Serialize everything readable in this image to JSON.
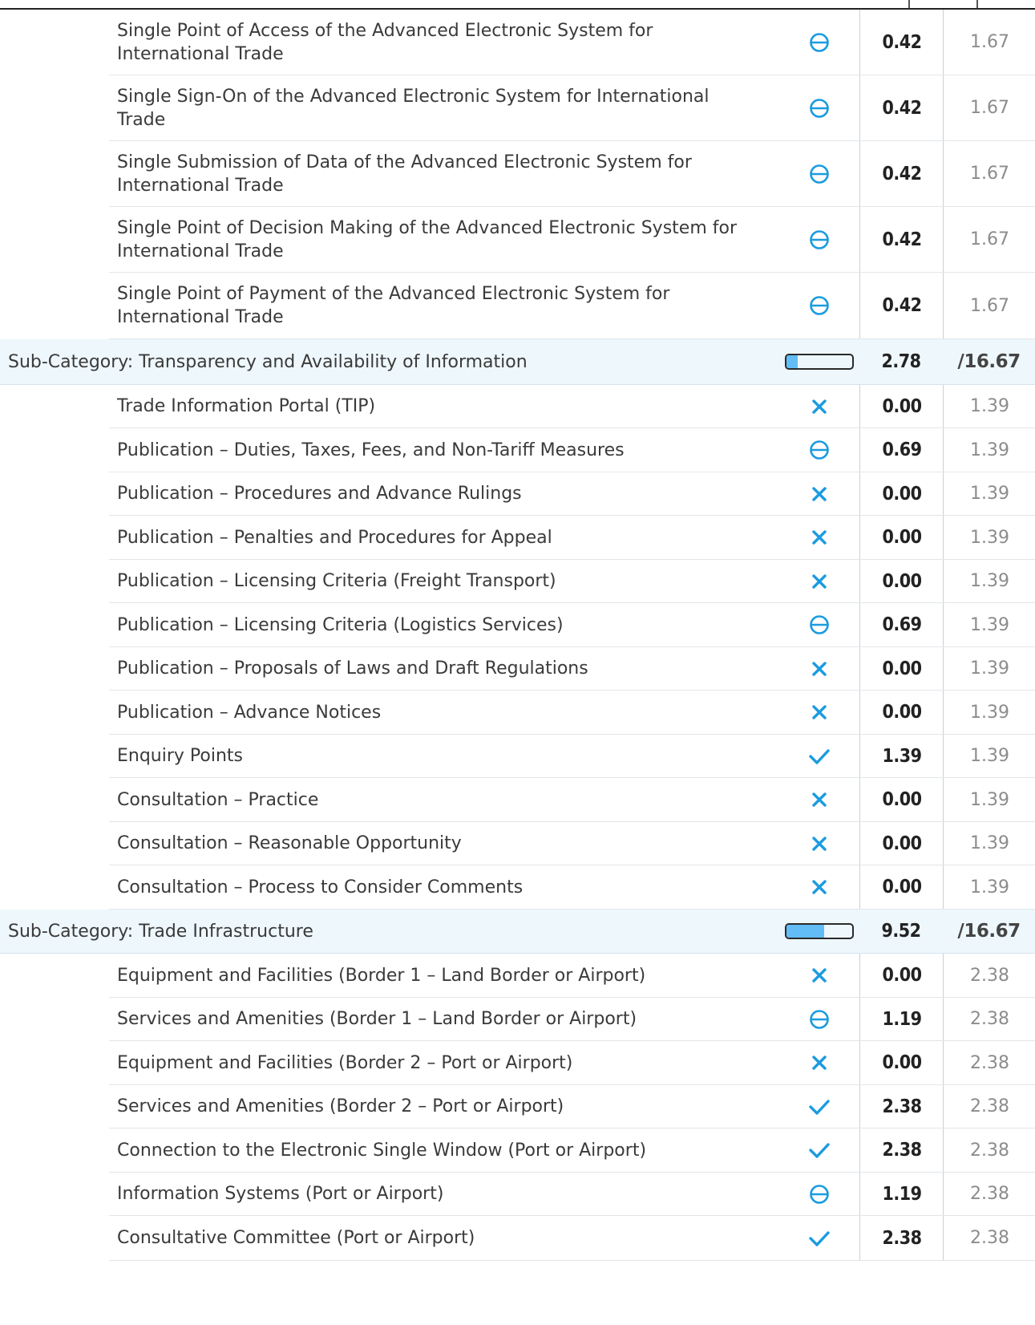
{
  "colors": {
    "accent": "#1a9be0",
    "bar_fill": "#62bdf6",
    "subcategory_bg": "#eef7fc"
  },
  "rows": [
    {
      "kind": "item",
      "h": 82,
      "label": "Single Point of Access of the Advanced Electronic System for International Trade",
      "icon": "partial",
      "score": "0.42",
      "max": "1.67"
    },
    {
      "kind": "item",
      "h": 82,
      "label": "Single Sign-On of the Advanced Electronic System for International Trade",
      "icon": "partial",
      "score": "0.42",
      "max": "1.67"
    },
    {
      "kind": "item",
      "h": 82,
      "label": "Single Submission of Data of the Advanced Electronic System for International Trade",
      "icon": "partial",
      "score": "0.42",
      "max": "1.67"
    },
    {
      "kind": "item",
      "h": 82,
      "label": "Single Point of Decision Making of the Advanced Electronic System for International Trade",
      "icon": "partial",
      "score": "0.42",
      "max": "1.67"
    },
    {
      "kind": "item",
      "h": 83,
      "label": "Single Point of Payment of the Advanced Electronic System for International Trade",
      "icon": "partial",
      "score": "0.42",
      "max": "1.67"
    },
    {
      "kind": "sub",
      "h": 57,
      "label": "Sub-Category: Transparency and Availability of Information",
      "progress": 0.17,
      "score": "2.78",
      "max": "/16.67"
    },
    {
      "kind": "item",
      "h": 54,
      "label": "Trade Information Portal (TIP)",
      "icon": "cross",
      "score": "0.00",
      "max": "1.39"
    },
    {
      "kind": "item",
      "h": 55,
      "label": "Publication – Duties, Taxes, Fees, and Non-Tariff Measures",
      "icon": "partial",
      "score": "0.69",
      "max": "1.39"
    },
    {
      "kind": "item",
      "h": 54,
      "label": "Publication – Procedures and Advance Rulings",
      "icon": "cross",
      "score": "0.00",
      "max": "1.39"
    },
    {
      "kind": "item",
      "h": 55,
      "label": "Publication – Penalties and Procedures for Appeal",
      "icon": "cross",
      "score": "0.00",
      "max": "1.39"
    },
    {
      "kind": "item",
      "h": 54,
      "label": "Publication – Licensing Criteria (Freight Transport)",
      "icon": "cross",
      "score": "0.00",
      "max": "1.39"
    },
    {
      "kind": "item",
      "h": 55,
      "label": "Publication – Licensing Criteria (Logistics Services)",
      "icon": "partial",
      "score": "0.69",
      "max": "1.39"
    },
    {
      "kind": "item",
      "h": 54,
      "label": "Publication – Proposals of Laws and Draft Regulations",
      "icon": "cross",
      "score": "0.00",
      "max": "1.39"
    },
    {
      "kind": "item",
      "h": 55,
      "label": "Publication – Advance Notices",
      "icon": "cross",
      "score": "0.00",
      "max": "1.39"
    },
    {
      "kind": "item",
      "h": 54,
      "label": "Enquiry Points",
      "icon": "check",
      "score": "1.39",
      "max": "1.39"
    },
    {
      "kind": "item",
      "h": 55,
      "label": "Consultation – Practice",
      "icon": "cross",
      "score": "0.00",
      "max": "1.39"
    },
    {
      "kind": "item",
      "h": 54,
      "label": "Consultation – Reasonable Opportunity",
      "icon": "cross",
      "score": "0.00",
      "max": "1.39"
    },
    {
      "kind": "item",
      "h": 55,
      "label": "Consultation – Process to Consider Comments",
      "icon": "cross",
      "score": "0.00",
      "max": "1.39"
    },
    {
      "kind": "sub",
      "h": 55,
      "label": "Sub-Category: Trade Infrastructure",
      "progress": 0.57,
      "score": "9.52",
      "max": "/16.67"
    },
    {
      "kind": "item",
      "h": 55,
      "label": "Equipment and Facilities (Border 1 – Land Border or Airport)",
      "icon": "cross",
      "score": "0.00",
      "max": "2.38"
    },
    {
      "kind": "item",
      "h": 54,
      "label": "Services and Amenities (Border 1 – Land Border or Airport)",
      "icon": "partial",
      "score": "1.19",
      "max": "2.38"
    },
    {
      "kind": "item",
      "h": 55,
      "label": "Equipment and Facilities (Border 2 – Port or Airport)",
      "icon": "cross",
      "score": "0.00",
      "max": "2.38"
    },
    {
      "kind": "item",
      "h": 54,
      "label": "Services and Amenities (Border 2 – Port or Airport)",
      "icon": "check",
      "score": "2.38",
      "max": "2.38"
    },
    {
      "kind": "item",
      "h": 55,
      "label": "Connection to the Electronic Single Window (Port or Airport)",
      "icon": "check",
      "score": "2.38",
      "max": "2.38"
    },
    {
      "kind": "item",
      "h": 54,
      "label": "Information Systems (Port or Airport)",
      "icon": "partial",
      "score": "1.19",
      "max": "2.38"
    },
    {
      "kind": "item",
      "h": 56,
      "label": "Consultative Committee (Port or Airport)",
      "icon": "check",
      "score": "2.38",
      "max": "2.38"
    }
  ]
}
